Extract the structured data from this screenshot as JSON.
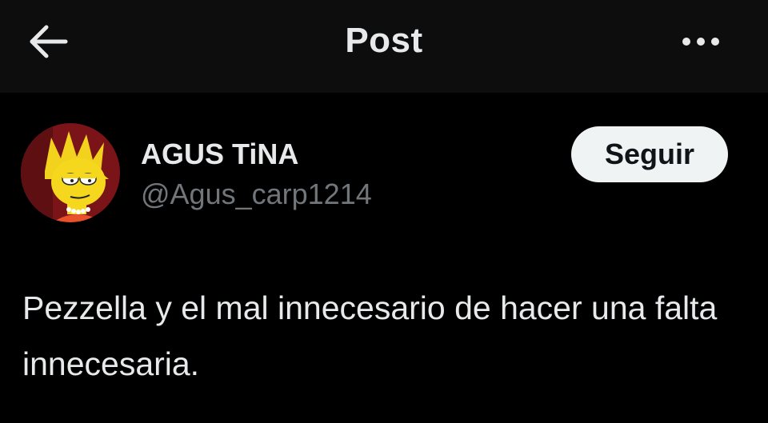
{
  "header": {
    "title": "Post",
    "back_icon": "arrow-left-icon",
    "more_icon": "more-horizontal-icon"
  },
  "author": {
    "display_name": "AGUS TiNA",
    "handle": "@Agus_carp1214",
    "avatar": "avatar-image"
  },
  "actions": {
    "follow_label": "Seguir"
  },
  "post": {
    "text": "Pezzella y el mal innecesario de hacer una falta innecesaria."
  },
  "colors": {
    "background": "#000000",
    "header_background": "#0d0d0d",
    "primary_text": "#e7e9ea",
    "secondary_text": "#71767b",
    "follow_button_bg": "#eff3f4",
    "follow_button_text": "#0f1419"
  }
}
